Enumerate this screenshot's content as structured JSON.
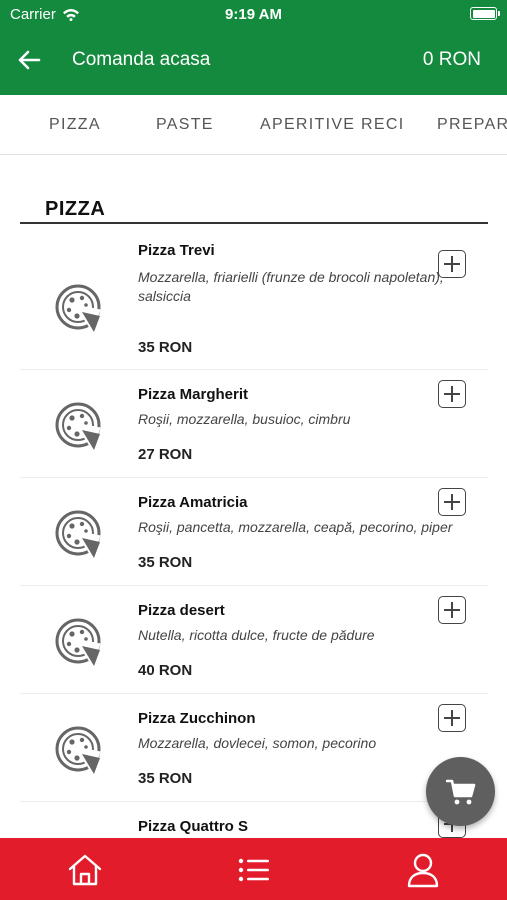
{
  "status_bar": {
    "carrier": "Carrier",
    "time": "9:19 AM",
    "icons": [
      "wifi-icon",
      "battery-icon"
    ]
  },
  "header": {
    "title": "Comanda acasa",
    "total": "0 RON",
    "back_icon": "arrow-left-icon"
  },
  "tabs": [
    {
      "label": "PIZZA"
    },
    {
      "label": "PASTE"
    },
    {
      "label": "APERITIVE RECI"
    },
    {
      "label": "PREPAR"
    }
  ],
  "section": {
    "title": "PIZZA"
  },
  "items": [
    {
      "name": "Pizza Trevi",
      "description": "Mozzarella, friarielli (frunze de brocoli napoletan), salsiccia",
      "price": "35 RON"
    },
    {
      "name": "Pizza Margherit",
      "description": "Roşii, mozzarella, busuioc, cimbru",
      "price": "27 RON"
    },
    {
      "name": "Pizza Amatricia",
      "description": "Roşii, pancetta, mozzarella, ceapă, pecorino, piper",
      "price": "35 RON"
    },
    {
      "name": "Pizza desert",
      "description": "Nutella, ricotta dulce, fructe de pădure",
      "price": "40 RON"
    },
    {
      "name": "Pizza Zucchinon",
      "description": "Mozzarella, dovlecei, somon, pecorino",
      "price": "35 RON"
    },
    {
      "name": "Pizza Quattro S",
      "description": "",
      "price": ""
    }
  ],
  "colors": {
    "header": "#138a3e",
    "bottom_bar": "#e31c2b",
    "cart_button": "#5f5f5f"
  },
  "cart_icon": "shopping-cart-icon",
  "bottom_nav": [
    {
      "icon": "home-icon"
    },
    {
      "icon": "menu-list-icon"
    },
    {
      "icon": "user-icon"
    }
  ]
}
